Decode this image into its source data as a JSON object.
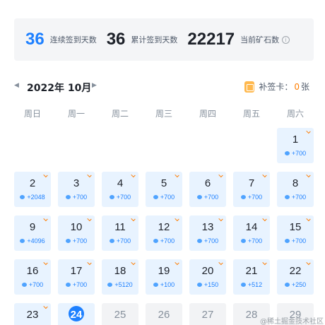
{
  "stats": {
    "consecutive_days": "36",
    "consecutive_label": "连续签到天数",
    "total_days": "36",
    "total_label": "累计签到天数",
    "ore": "22217",
    "ore_label": "当前矿石数",
    "info_glyph": "i"
  },
  "calendar": {
    "title": "2022年 10月",
    "prev_icon": "◀",
    "next_icon": "▶",
    "makeup_label": "补签卡：",
    "makeup_count": "0",
    "makeup_unit": "张",
    "weekdays": [
      "周日",
      "周一",
      "周二",
      "周三",
      "周四",
      "周五",
      "周六"
    ],
    "days": [
      {
        "day": "1",
        "reward": "+700",
        "signed": true
      },
      {
        "day": "2",
        "reward": "+2048",
        "signed": true
      },
      {
        "day": "3",
        "reward": "+700",
        "signed": true
      },
      {
        "day": "4",
        "reward": "+700",
        "signed": true
      },
      {
        "day": "5",
        "reward": "+700",
        "signed": true
      },
      {
        "day": "6",
        "reward": "+700",
        "signed": true
      },
      {
        "day": "7",
        "reward": "+700",
        "signed": true
      },
      {
        "day": "8",
        "reward": "+700",
        "signed": true
      },
      {
        "day": "9",
        "reward": "+4096",
        "signed": true
      },
      {
        "day": "10",
        "reward": "+700",
        "signed": true
      },
      {
        "day": "11",
        "reward": "+700",
        "signed": true
      },
      {
        "day": "12",
        "reward": "+700",
        "signed": true
      },
      {
        "day": "13",
        "reward": "+700",
        "signed": true
      },
      {
        "day": "14",
        "reward": "+700",
        "signed": true
      },
      {
        "day": "15",
        "reward": "+700",
        "signed": true
      },
      {
        "day": "16",
        "reward": "+700",
        "signed": true
      },
      {
        "day": "17",
        "reward": "+700",
        "signed": true
      },
      {
        "day": "18",
        "reward": "+5120",
        "signed": true
      },
      {
        "day": "19",
        "reward": "+100",
        "signed": true
      },
      {
        "day": "20",
        "reward": "+150",
        "signed": true
      },
      {
        "day": "21",
        "reward": "+512",
        "signed": true
      },
      {
        "day": "22",
        "reward": "+250",
        "signed": true
      },
      {
        "day": "23",
        "reward": "",
        "signed": true
      },
      {
        "day": "24",
        "reward": "",
        "signed": false,
        "today": true
      },
      {
        "day": "25",
        "reward": "",
        "signed": false,
        "future": true
      },
      {
        "day": "26",
        "reward": "",
        "signed": false,
        "future": true
      },
      {
        "day": "27",
        "reward": "",
        "signed": false,
        "future": true
      },
      {
        "day": "28",
        "reward": "",
        "signed": false,
        "future": true
      },
      {
        "day": "29",
        "reward": "",
        "signed": false,
        "future": true
      }
    ]
  },
  "watermark": "@稀土掘金技术社区",
  "colors": {
    "accent": "#1e80ff",
    "cell_bg": "#e8f3ff",
    "check": "#ff7d00"
  }
}
